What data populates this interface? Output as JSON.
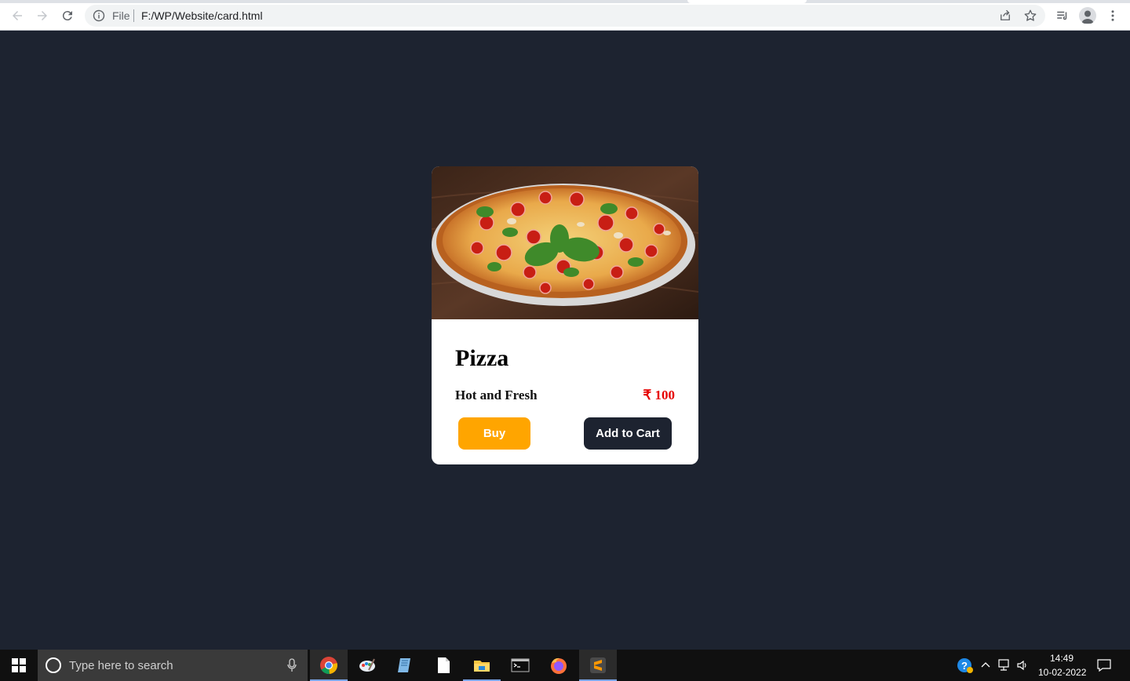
{
  "browser": {
    "file_label": "File",
    "url": "F:/WP/Website/card.html"
  },
  "card": {
    "title": "Pizza",
    "subtitle": "Hot and Fresh",
    "price": "₹ 100",
    "buy_label": "Buy",
    "cart_label": "Add to Cart"
  },
  "taskbar": {
    "search_placeholder": "Type here to search",
    "time": "14:49",
    "date": "10-02-2022"
  },
  "colors": {
    "page_background": "#1d2330",
    "buy_button": "#ffa500",
    "cart_button": "#1d2330",
    "price": "#e60000"
  },
  "icons": [
    "back-icon",
    "forward-icon",
    "reload-icon",
    "info-icon",
    "share-icon",
    "star-icon",
    "reading-list-icon",
    "profile-icon",
    "menu-icon",
    "windows-start-icon",
    "cortana-icon",
    "mic-icon",
    "chrome-icon",
    "paint-icon",
    "notepad-icon",
    "document-icon",
    "file-explorer-icon",
    "terminal-icon",
    "firefox-icon",
    "sublime-icon",
    "help-icon",
    "chevron-up-icon",
    "network-icon",
    "volume-icon",
    "notification-icon"
  ]
}
